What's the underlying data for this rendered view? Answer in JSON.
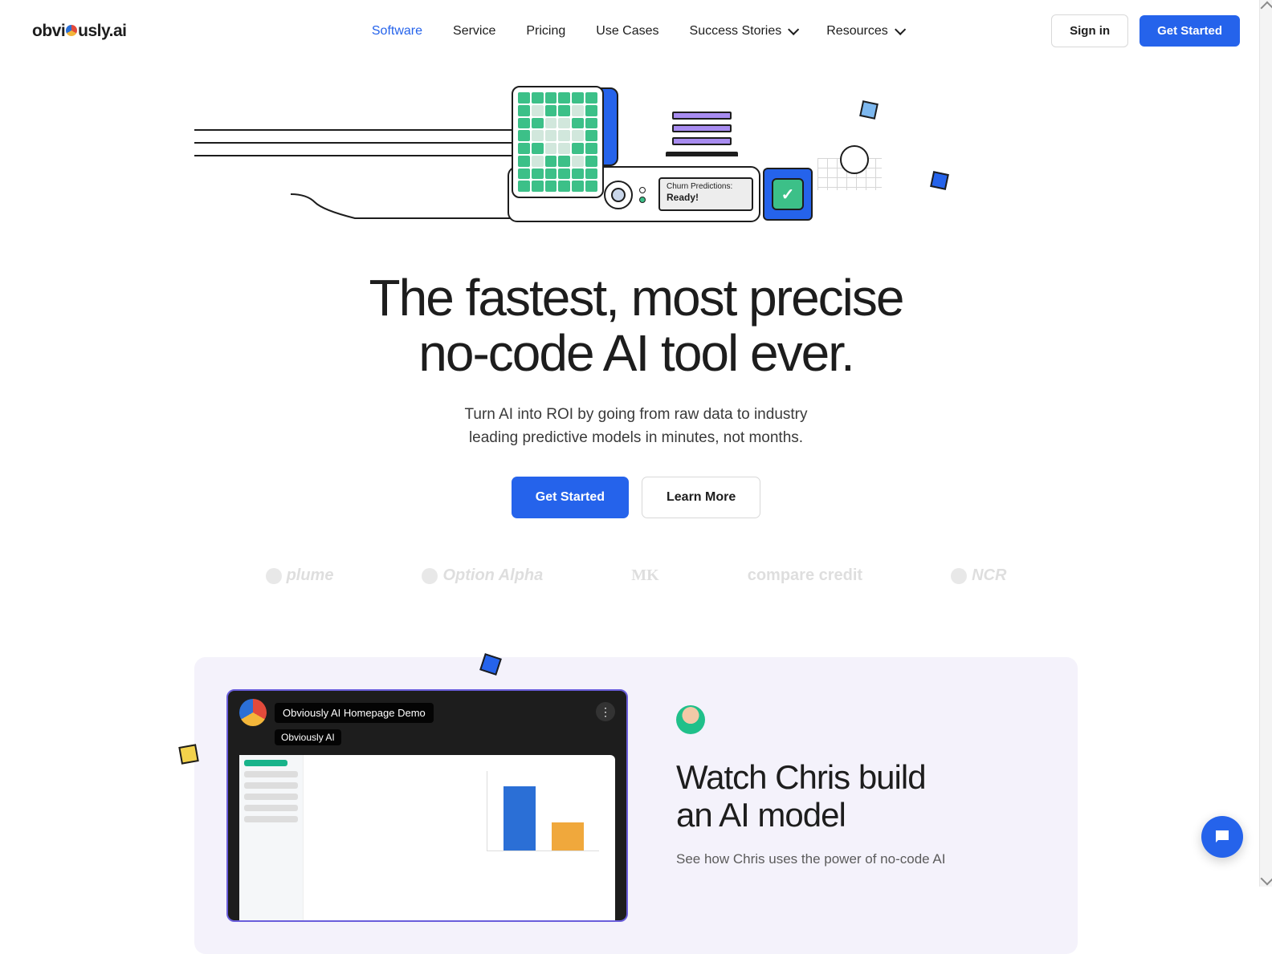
{
  "brand": {
    "name_left": "obvi",
    "name_right": "usly.ai"
  },
  "nav": {
    "items": [
      {
        "label": "Software",
        "active": true,
        "dropdown": false
      },
      {
        "label": "Service",
        "dropdown": false
      },
      {
        "label": "Pricing",
        "dropdown": false
      },
      {
        "label": "Use Cases",
        "dropdown": false
      },
      {
        "label": "Success Stories",
        "dropdown": true
      },
      {
        "label": "Resources",
        "dropdown": true
      }
    ]
  },
  "auth": {
    "signin": "Sign in",
    "get_started": "Get Started"
  },
  "illustration": {
    "status_label": "Churn Predictions:",
    "status_value": "Ready!",
    "check": "✓"
  },
  "hero": {
    "headline_l1": "The fastest, most precise",
    "headline_l2": "no-code AI tool ever.",
    "sub_l1": "Turn AI into ROI by going from raw data to industry",
    "sub_l2": "leading predictive models in minutes, not months.",
    "cta_primary": "Get Started",
    "cta_secondary": "Learn More"
  },
  "clients": [
    {
      "name": "plume"
    },
    {
      "name": "Option Alpha"
    },
    {
      "name": "MK"
    },
    {
      "name": "compare credit"
    },
    {
      "name": "NCR"
    }
  ],
  "watch": {
    "video_title": "Obviously AI Homepage Demo",
    "video_channel": "Obviously AI",
    "heading_l1": "Watch Chris build",
    "heading_l2": "an AI model",
    "body": "See how Chris uses the power of no-code AI"
  },
  "colors": {
    "accent": "#2563eb",
    "green": "#3cc088",
    "purple": "#a88cf0",
    "panel": "#f4f2fb"
  }
}
